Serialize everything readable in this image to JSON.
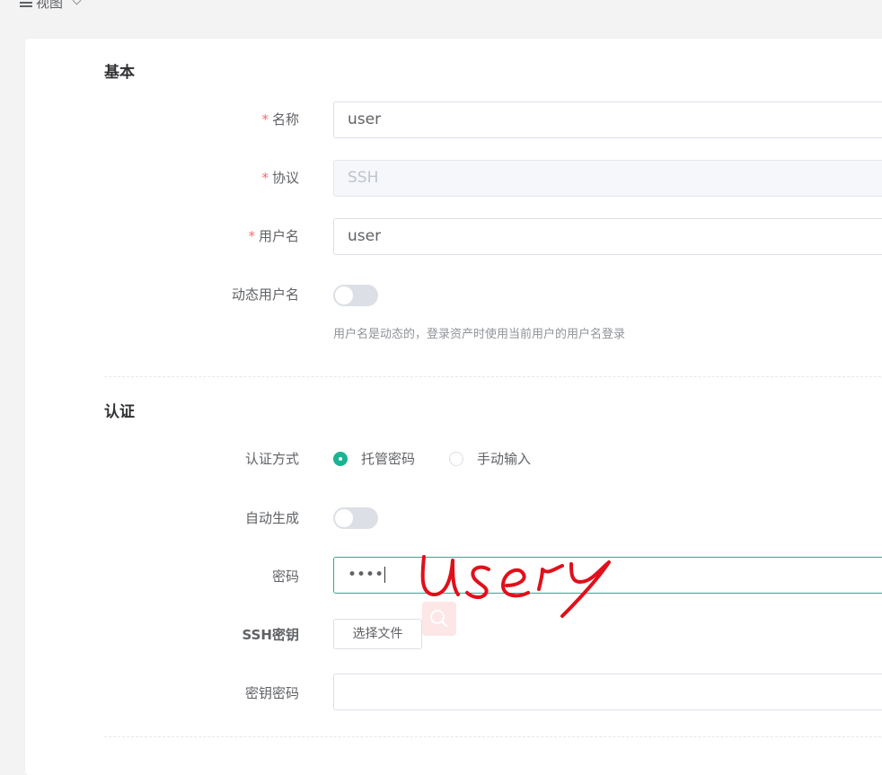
{
  "header": {
    "view_menu_label": "视图"
  },
  "sections": {
    "basic": {
      "title": "基本",
      "name_label": "名称",
      "name_value": "user",
      "protocol_label": "协议",
      "protocol_placeholder": "SSH",
      "username_label": "用户名",
      "username_value": "user",
      "dynamic_username_label": "动态用户名",
      "dynamic_username_enabled": false,
      "dynamic_username_hint": "用户名是动态的，登录资产时使用当前用户的用户名登录"
    },
    "auth": {
      "title": "认证",
      "auth_method_label": "认证方式",
      "auth_options": [
        "托管密码",
        "手动输入"
      ],
      "auth_selected": "托管密码",
      "auto_generate_label": "自动生成",
      "auto_generate_enabled": false,
      "password_label": "密码",
      "password_value": "••••",
      "ssh_key_label": "SSH密钥",
      "ssh_key_button": "选择文件",
      "key_password_label": "密钥密码",
      "key_password_value": ""
    }
  },
  "annotation": {
    "handwritten_text": "user",
    "color": "#e0101a"
  },
  "colors": {
    "accent": "#1ab394",
    "required": "#f56c6c"
  },
  "icons": {
    "menu": "hamburger-icon",
    "dropdown": "chevron-down-icon",
    "search": "search-icon"
  }
}
